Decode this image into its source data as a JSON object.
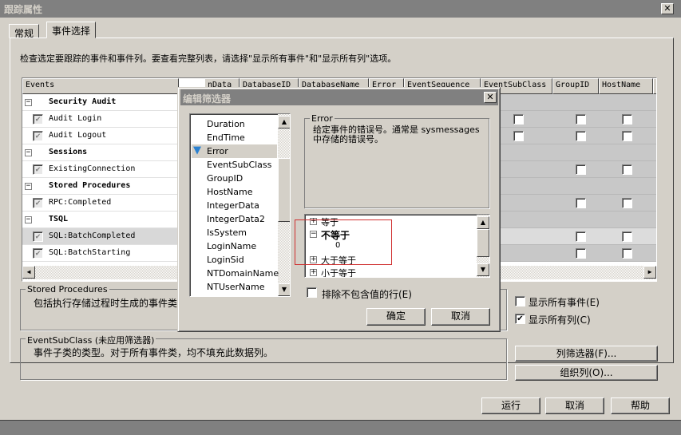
{
  "window": {
    "title": "跟踪属性",
    "close": "✕"
  },
  "tabs": [
    {
      "label": "常规"
    },
    {
      "label": "事件选择"
    }
  ],
  "description": "检查选定要跟踪的事件和事件列。要查看完整列表，请选择\"显示所有事件\"和\"显示所有列\"选项。",
  "grid": {
    "columns": [
      "Events",
      "nData",
      "DatabaseID",
      "DatabaseName",
      "Error",
      "EventSequence",
      "EventSubClass",
      "GroupID",
      "HostName",
      "I"
    ],
    "rows": [
      {
        "label": "Security Audit",
        "type": "category"
      },
      {
        "label": "Audit Login",
        "type": "event",
        "checked": true
      },
      {
        "label": "Audit Logout",
        "type": "event",
        "checked": true
      },
      {
        "label": "Sessions",
        "type": "category"
      },
      {
        "label": "ExistingConnection",
        "type": "event",
        "checked": true
      },
      {
        "label": "Stored Procedures",
        "type": "category"
      },
      {
        "label": "RPC:Completed",
        "type": "event",
        "checked": true
      },
      {
        "label": "TSQL",
        "type": "category"
      },
      {
        "label": "SQL:BatchCompleted",
        "type": "event",
        "checked": true,
        "selected": true
      },
      {
        "label": "SQL:BatchStarting",
        "type": "event",
        "checked": true
      }
    ]
  },
  "stored_procedures_group": {
    "title": "Stored Procedures",
    "text": "包括执行存储过程时生成的事件类"
  },
  "eventsubclass_group": {
    "title": "EventSubClass (未应用筛选器)",
    "text": "事件子类的类型。对于所有事件类，均不填充此数据列。"
  },
  "options": {
    "show_all_events": "显示所有事件(E)",
    "show_all_events_checked": false,
    "show_all_columns": "显示所有列(C)",
    "show_all_columns_checked": true
  },
  "buttons": {
    "column_filter": "列筛选器(F)...",
    "organize_columns": "组织列(O)...",
    "run": "运行",
    "cancel": "取消",
    "help": "帮助"
  },
  "filter_dialog": {
    "title": "编辑筛选器",
    "columns": [
      "Duration",
      "EndTime",
      "Error",
      "EventSubClass",
      "GroupID",
      "HostName",
      "IntegerData",
      "IntegerData2",
      "IsSystem",
      "LoginName",
      "LoginSid",
      "NTDomainName",
      "NTUserName"
    ],
    "selected_column": "Error",
    "desc_title": "Error",
    "desc_text": "给定事件的错误号。通常是 sysmessages 中存储的错误号。",
    "tree": [
      {
        "label": "等于",
        "expanded": false
      },
      {
        "label": "不等于",
        "expanded": true,
        "children": [
          "0"
        ]
      },
      {
        "label": "大于等于",
        "expanded": false
      },
      {
        "label": "小于等于",
        "expanded": false
      }
    ],
    "exclude_rows": "排除不包含值的行(E)",
    "exclude_rows_checked": false,
    "ok": "确定",
    "cancel": "取消",
    "highlight_color": "#d03030"
  }
}
